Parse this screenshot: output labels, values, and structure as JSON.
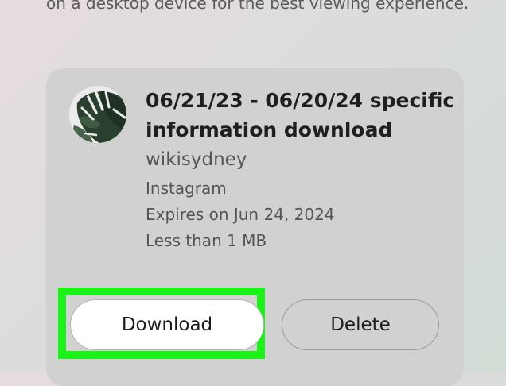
{
  "intro_text": "on a desktop device for the best viewing experience.",
  "card": {
    "title": "06/21/23 - 06/20/24 specific information download",
    "account": "wikisydney",
    "platform": "Instagram",
    "expires": "Expires on Jun 24, 2024",
    "size": "Less than 1 MB",
    "avatar_icon": "monstera-leaf-avatar",
    "download_label": "Download",
    "delete_label": "Delete",
    "highlight_color": "#1cf11a"
  }
}
